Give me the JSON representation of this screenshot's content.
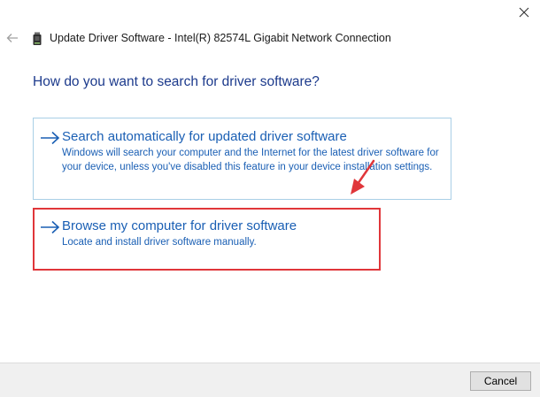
{
  "window": {
    "title": "Update Driver Software - Intel(R) 82574L Gigabit Network Connection",
    "icons": {
      "close": "close-icon",
      "back": "back-arrow-icon",
      "device": "device-icon"
    }
  },
  "main": {
    "heading": "How do you want to search for driver software?",
    "options": [
      {
        "title": "Search automatically for updated driver software",
        "description": "Windows will search your computer and the Internet for the latest driver software for your device, unless you've disabled this feature in your device installation settings."
      },
      {
        "title": "Browse my computer for driver software",
        "description": "Locate and install driver software manually.",
        "highlighted": true
      }
    ]
  },
  "footer": {
    "cancel_label": "Cancel"
  },
  "colors": {
    "heading": "#1c3a8c",
    "link": "#1a5fb4",
    "option_border": "#a9cfe6",
    "highlight": "#e0363a",
    "footer_bg": "#f0f0f0"
  }
}
